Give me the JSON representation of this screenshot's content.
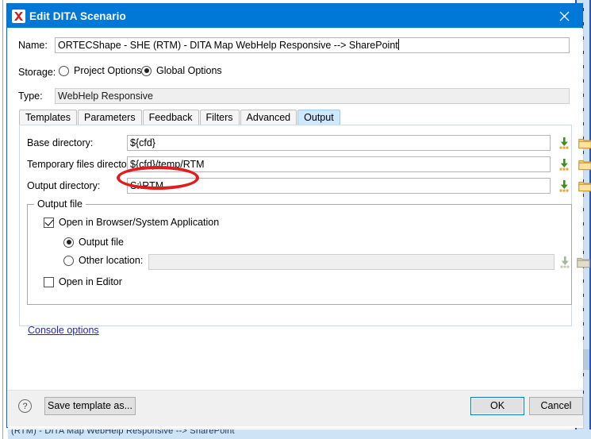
{
  "window": {
    "title": "Edit DITA Scenario",
    "app_icon": "oxygen-x-icon",
    "close_label": "✕",
    "titlebar_color": "#0078d7"
  },
  "form": {
    "name_label": "Name:",
    "name_value": "ORTECShape - SHE (RTM) - DITA Map WebHelp Responsive --> SharePoint",
    "storage_label": "Storage:",
    "storage_options": [
      {
        "label": "Project Options",
        "selected": false
      },
      {
        "label": "Global Options",
        "selected": true
      }
    ],
    "type_label": "Type:",
    "type_value": "WebHelp Responsive"
  },
  "tabs": [
    {
      "label": "Templates",
      "active": false
    },
    {
      "label": "Parameters",
      "active": false
    },
    {
      "label": "Feedback",
      "active": false
    },
    {
      "label": "Filters",
      "active": false
    },
    {
      "label": "Advanced",
      "active": false
    },
    {
      "label": "Output",
      "active": true
    }
  ],
  "output_tab": {
    "fields": [
      {
        "label": "Base directory:",
        "value": "${cfd}",
        "insert_icon": "green-down-arrow-icon",
        "browse_icon": "folder-icon",
        "highlighted": false
      },
      {
        "label": "Temporary files directory:",
        "value": "${cfd}/temp/RTM",
        "insert_icon": "green-down-arrow-icon",
        "browse_icon": "folder-icon",
        "highlighted": false
      },
      {
        "label": "Output directory:",
        "value": "S:\\RTM",
        "insert_icon": "green-down-arrow-icon",
        "browse_icon": "folder-icon",
        "highlighted": true
      }
    ],
    "output_file_group": {
      "title": "Output file",
      "open_in_browser": {
        "label": "Open in Browser/System Application",
        "checked": true
      },
      "radios": [
        {
          "label": "Output file",
          "selected": true
        },
        {
          "label": "Other location:",
          "selected": false
        }
      ],
      "other_location_value": "",
      "other_insert_icon": "green-down-arrow-icon-disabled",
      "other_browse_icon": "folder-icon-disabled",
      "open_in_editor": {
        "label": "Open in Editor",
        "checked": false
      }
    },
    "console_options_link": "Console options"
  },
  "footer": {
    "help_icon": "question-mark-icon",
    "help_glyph": "?",
    "save_template_label": "Save template as...",
    "ok_label": "OK",
    "cancel_label": "Cancel"
  },
  "background": {
    "clipped_text": "(RTM) - DITA Map WebHelp Responsive --> SharePoint"
  },
  "annotation": {
    "shape": "red-ellipse",
    "color": "#e21b1b",
    "targets": "output-directory-field"
  }
}
